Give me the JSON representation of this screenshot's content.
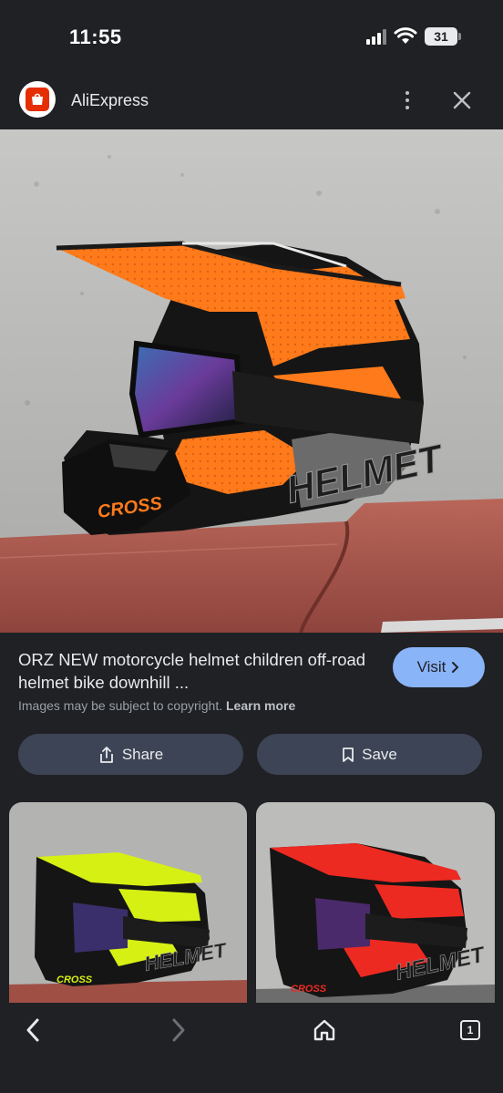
{
  "status_bar": {
    "time": "11:55",
    "battery": "31"
  },
  "header": {
    "app_name": "AliExpress",
    "logo_text": "AliExpress"
  },
  "hero": {
    "helmet_brand_text": "CROSS",
    "helmet_side_text": "HELMET",
    "colors": {
      "shell": "#ff7a1a",
      "black": "#141414",
      "seat": "#a8574e",
      "wall": "#b9b9b9"
    }
  },
  "result": {
    "title": "ORZ NEW motorcycle helmet children off-road helmet bike downhill ...",
    "visit_label": "Visit",
    "copyright_text": "Images may be subject to copyright.",
    "learn_more_label": "Learn more"
  },
  "actions": {
    "share_label": "Share",
    "save_label": "Save"
  },
  "thumbnails": [
    {
      "brand_text": "CROSS",
      "side_text": "HELMET",
      "accent": "#d6f014"
    },
    {
      "brand_text": "CROSS",
      "side_text": "HELMET",
      "accent": "#ec2a22"
    }
  ],
  "bottom_nav": {
    "tab_count": "1"
  },
  "accent_colors": {
    "visit": "#8ab4f8",
    "action_bg": "#3c4455",
    "background": "#202124"
  }
}
